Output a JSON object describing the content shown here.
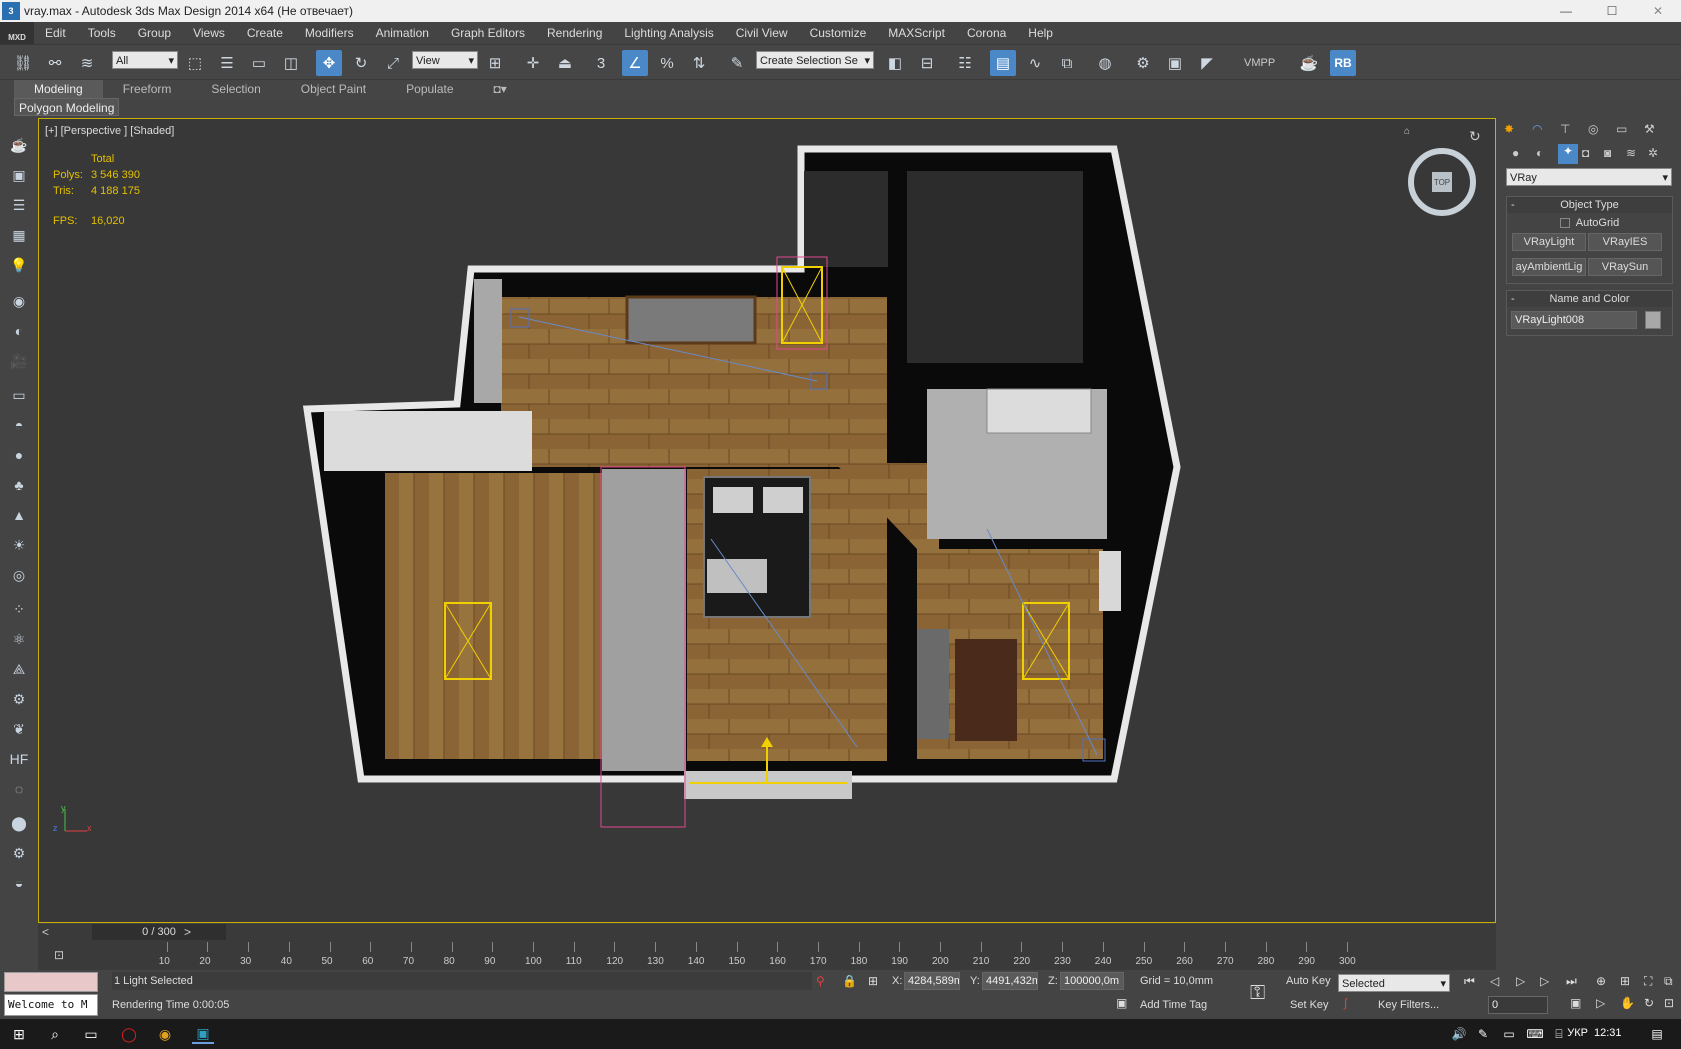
{
  "titlebar": {
    "title": "vray.max - Autodesk 3ds Max Design 2014 x64    (Не отвечает)",
    "minimize": "—",
    "maximize": "☐",
    "close": "✕"
  },
  "menubar": {
    "logo": "MXD",
    "items": [
      "Edit",
      "Tools",
      "Group",
      "Views",
      "Create",
      "Modifiers",
      "Animation",
      "Graph Editors",
      "Rendering",
      "Lighting Analysis",
      "Civil View",
      "Customize",
      "MAXScript",
      "Corona",
      "Help"
    ]
  },
  "toolbar": {
    "selection_filter": "All",
    "reference_coord": "View",
    "selection_set_placeholder": "Create Selection Se",
    "snap_number": "3",
    "vmpp_label": "VMPP",
    "rb_label": "RB"
  },
  "ribbon": {
    "tabs": [
      "Modeling",
      "Freeform",
      "Selection",
      "Object Paint",
      "Populate"
    ],
    "active_tab": "Modeling",
    "panel_label": "Polygon Modeling"
  },
  "viewport": {
    "label": "[+] [Perspective ] [Shaded]",
    "stats": {
      "header": "Total",
      "polys_label": "Polys:",
      "polys_value": "3 546 390",
      "tris_label": "Tris:",
      "tris_value": "4 188 175",
      "fps_label": "FPS:",
      "fps_value": "16,020"
    },
    "viewcube_face": "TOP",
    "axis_x": "x",
    "axis_y": "y",
    "axis_z": "z"
  },
  "command_panel": {
    "renderer_dropdown": "VRay",
    "object_type_title": "Object Type",
    "autogrid_label": "AutoGrid",
    "buttons": [
      "VRayLight",
      "VRayIES",
      "ayAmbientLig",
      "VRaySun"
    ],
    "name_color_title": "Name and Color",
    "object_name": "VRayLight008",
    "swatch_color": "#a8a8a8"
  },
  "timeline": {
    "frame_display": "0 / 300",
    "prev_arrow": "<",
    "next_arrow": ">",
    "ticks": [
      "10",
      "20",
      "30",
      "40",
      "50",
      "60",
      "70",
      "80",
      "90",
      "100",
      "110",
      "120",
      "130",
      "140",
      "150",
      "160",
      "170",
      "180",
      "190",
      "200",
      "210",
      "220",
      "230",
      "240",
      "250",
      "260",
      "270",
      "280",
      "290",
      "300"
    ]
  },
  "statusbar": {
    "maxscript_listener": "Welcome to M",
    "selection_status": "1 Light Selected",
    "render_time": "Rendering Time  0:00:05",
    "x_label": "X:",
    "x_value": "4284,589m",
    "y_label": "Y:",
    "y_value": "4491,432m",
    "z_label": "Z:",
    "z_value": "100000,0m",
    "grid": "Grid = 10,0mm",
    "add_time_tag": "Add Time Tag",
    "auto_key": "Auto Key",
    "set_key": "Set Key",
    "key_filter_dropdown": "Selected",
    "key_filters": "Key Filters...",
    "current_frame": "0"
  },
  "taskbar": {
    "lang": "УКР",
    "clock": "12:31"
  },
  "colors": {
    "viewport_border": "#c8b000",
    "stats_text": "#e4c000",
    "floor_wood": "#8a6434",
    "wall_white": "#e8e8e8",
    "light_yellow": "#f0d000",
    "selection_pink": "#e04890",
    "light_blue": "#5070c0"
  }
}
